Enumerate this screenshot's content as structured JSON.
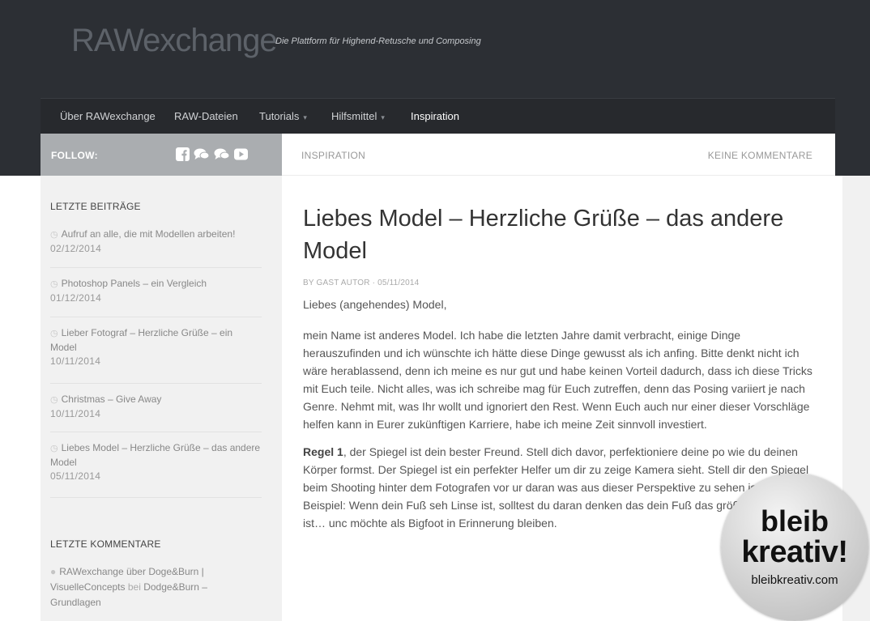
{
  "header": {
    "site_title": "RAWexchange",
    "tagline": "Die Plattform für Highend-Retusche und Composing",
    "bg_color": "#2c2f34"
  },
  "nav": {
    "items": [
      {
        "label": "Über RAWexchange",
        "has_dropdown": false
      },
      {
        "label": "RAW-Dateien",
        "has_dropdown": false
      },
      {
        "label": "Tutorials",
        "has_dropdown": true
      },
      {
        "label": "Hilfsmittel",
        "has_dropdown": true
      },
      {
        "label": "Inspiration",
        "has_dropdown": false,
        "active": true
      }
    ],
    "caret": "▾"
  },
  "follow": {
    "label": "FOLLOW:",
    "icons": [
      "facebook-icon",
      "chat-icon",
      "chat-icon",
      "youtube-icon"
    ]
  },
  "breadcrumb": {
    "category": "INSPIRATION",
    "comments": "KEINE KOMMENTARE"
  },
  "sidebar": {
    "recent_heading": "LETZTE BEITRÄGE",
    "recent_posts": [
      {
        "title": "Aufruf an alle, die mit Modellen arbeiten!",
        "date": "02/12/2014"
      },
      {
        "title": "Photoshop Panels – ein Vergleich",
        "date": "01/12/2014"
      },
      {
        "title": "Lieber Fotograf – Herzliche Grüße – ein Model",
        "date": "10/11/2014"
      },
      {
        "title": "Christmas – Give Away",
        "date": "10/11/2014"
      },
      {
        "title": "Liebes Model – Herzliche Grüße – das andere Model",
        "date": "05/11/2014"
      }
    ],
    "comments_heading": "LETZTE KOMMENTARE",
    "comment": {
      "author": "RAWexchange über Doge&Burn | VisuelleConcepts",
      "on": "bei",
      "post": "Dodge&Burn – Grundlagen"
    }
  },
  "article": {
    "title": "Liebes Model – Herzliche Grüße – das andere Model",
    "byline": "BY GAST AUTOR · 05/11/2014",
    "salutation": "Liebes (angehendes) Model,",
    "body": "mein Name ist anderes Model. Ich habe die letzten Jahre damit verbracht, einige Dinge herauszufinden und ich wünschte ich hätte diese Dinge gewusst als ich anfing. Bitte denkt nicht ich wäre herablassend, denn ich meine es nur gut und habe keinen Vorteil dadurch, dass ich diese Tricks mit Euch teile. Nicht alles, was ich schreibe mag für Euch zutreffen, denn das Posing variiert je nach Genre. Nehmt mit, was Ihr wollt und ignoriert den Rest. Wenn Euch auch nur einer dieser Vorschläge helfen kann in Eurer zukünftigen Karriere, habe ich meine Zeit sinnvoll investiert.",
    "rule_label": "Regel 1",
    "rule_text": ", der Spiegel ist dein bester Freund. Stell dich davor, perfektioniere deine po wie du deinen Körper formst. Der Spiegel ist ein perfekter Helfer um dir zu zeige Kamera sieht. Stell dir den Spiegel beim Shooting hinter dem Fotografen vor ur daran was aus dieser Perspektive zu sehen ist. Ein Beispiel: Wenn dein Fuß seh Linse ist, solltest du daran denken das dein Fuß das größte Ding im Bild ist… unc möchte als Bigfoot in Erinnerung bleiben."
  },
  "badge": {
    "line1": "bleib",
    "line2": "kreativ!",
    "url": "bleibkreativ.com"
  }
}
